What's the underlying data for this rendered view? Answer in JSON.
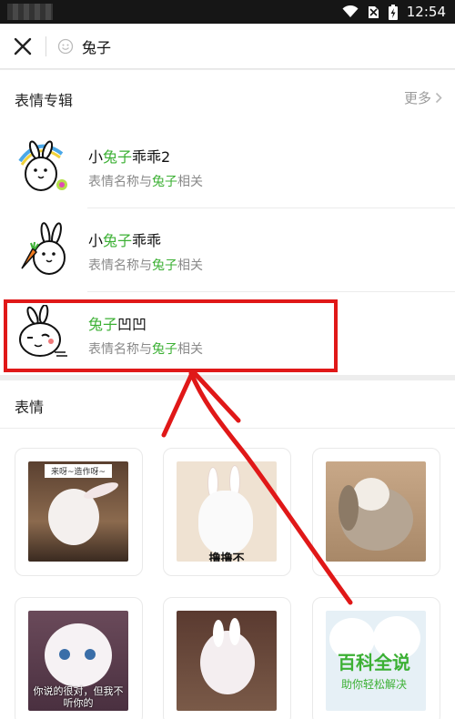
{
  "status_bar": {
    "time": "12:54"
  },
  "search": {
    "query": "兔子"
  },
  "album_section": {
    "title": "表情专辑",
    "more_label": "更多",
    "items": [
      {
        "name_prefix": "小",
        "name_highlight": "兔子",
        "name_suffix": "乖乖2",
        "sub_prefix": "表情名称与",
        "sub_highlight": "兔子",
        "sub_suffix": "相关"
      },
      {
        "name_prefix": "小",
        "name_highlight": "兔子",
        "name_suffix": "乖乖",
        "sub_prefix": "表情名称与",
        "sub_highlight": "兔子",
        "sub_suffix": "相关"
      },
      {
        "name_prefix": "",
        "name_highlight": "兔子",
        "name_suffix": "凹凹",
        "sub_prefix": "表情名称与",
        "sub_highlight": "兔子",
        "sub_suffix": "相关"
      }
    ]
  },
  "sticker_section": {
    "title": "表情",
    "stickers": [
      {
        "caption": "来呀~造作呀~"
      },
      {
        "caption": "撸撸不"
      },
      {
        "caption": ""
      },
      {
        "caption": "你说的很对，但我不听你的"
      },
      {
        "caption": ""
      },
      {
        "caption": ""
      }
    ]
  },
  "watermark": {
    "title": "百科全说",
    "subtitle": "助你轻松解决"
  },
  "colors": {
    "highlight_green": "#3cb034",
    "annotation_red": "#e01818"
  }
}
